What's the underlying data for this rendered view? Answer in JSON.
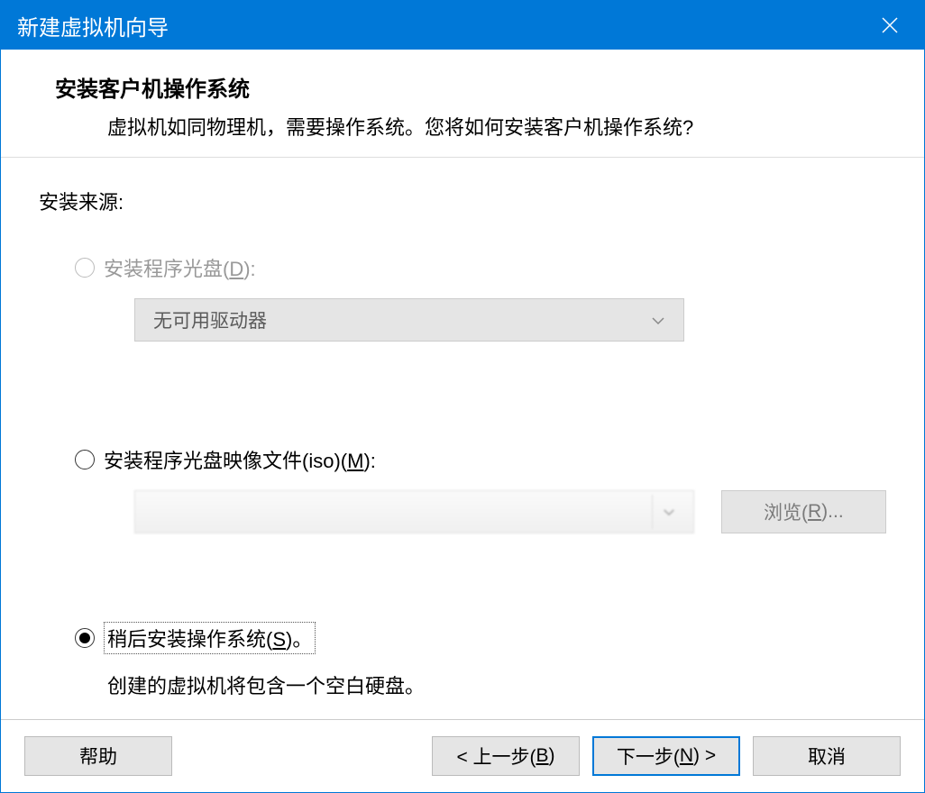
{
  "titlebar": {
    "title": "新建虚拟机向导"
  },
  "header": {
    "title": "安装客户机操作系统",
    "subtitle": "虚拟机如同物理机，需要操作系统。您将如何安装客户机操作系统?"
  },
  "content": {
    "source_label": "安装来源:",
    "option_disc": {
      "prefix": "安装程序光盘(",
      "accel": "D",
      "suffix": "):"
    },
    "disc_dropdown": "无可用驱动器",
    "option_iso": {
      "prefix": "安装程序光盘映像文件(iso)(",
      "accel": "M",
      "suffix": "):"
    },
    "browse_btn": {
      "prefix": "浏览(",
      "accel": "R",
      "suffix": ")..."
    },
    "option_later": {
      "prefix": "稍后安装操作系统(",
      "accel": "S",
      "suffix": ")。"
    },
    "later_hint": "创建的虚拟机将包含一个空白硬盘。"
  },
  "footer": {
    "help": "帮助",
    "back": {
      "prefix": "< 上一步(",
      "accel": "B",
      "suffix": ")"
    },
    "next": {
      "prefix": "下一步(",
      "accel": "N",
      "suffix": ") >"
    },
    "cancel": "取消"
  }
}
